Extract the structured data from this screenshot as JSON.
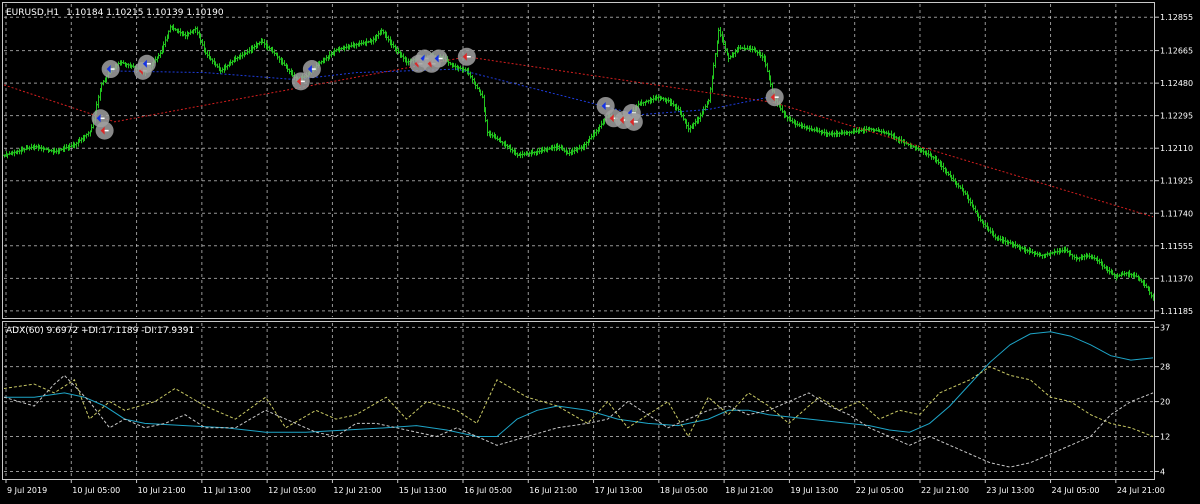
{
  "header": {
    "symbol": "EURUSD,H1",
    "ohlc": "1.10184 1.10215 1.10139 1.10190"
  },
  "indicator": {
    "label": "ADX(60) 9.6972 +DI:17.1189 -DI:17.9391"
  },
  "colors": {
    "background": "#000000",
    "frame": "#c8c8c8",
    "grid": "#c8c8c8",
    "bars": "#22c41e",
    "trend_line": "#d21e1e",
    "level_line": "#1e3cdc",
    "adx": "#1ea5c8",
    "plus_di": "#c8c864",
    "minus_di": "#c8c8c8",
    "marker_halo": "#a0a0a0",
    "marker_buy": "#1432e6",
    "marker_sell": "#dc2828",
    "text": "#ffffff"
  },
  "chart_data": [
    {
      "type": "candlestick",
      "title": "EURUSD,H1",
      "ylim": [
        1.1115,
        1.1293
      ],
      "y_ticks": [
        "1.12855",
        "1.12665",
        "1.12480",
        "1.12295",
        "1.12110",
        "1.11925",
        "1.11740",
        "1.11555",
        "1.11370",
        "1.11185"
      ],
      "x_ticks": [
        "9 Jul 2019",
        "10 Jul 05:00",
        "10 Jul 21:00",
        "11 Jul 13:00",
        "12 Jul 05:00",
        "12 Jul 21:00",
        "15 Jul 13:00",
        "16 Jul 05:00",
        "16 Jul 21:00",
        "17 Jul 13:00",
        "18 Jul 05:00",
        "18 Jul 21:00",
        "19 Jul 13:00",
        "22 Jul 05:00",
        "22 Jul 21:00",
        "23 Jul 13:00",
        "24 Jul 05:00",
        "24 Jul 21:00"
      ],
      "price_path": [
        [
          0,
          1.1207
        ],
        [
          3,
          1.1212
        ],
        [
          5,
          1.1209
        ],
        [
          7,
          1.1213
        ],
        [
          8.6,
          1.1221
        ],
        [
          9.6,
          1.1247
        ],
        [
          10.5,
          1.1255
        ],
        [
          11.5,
          1.126
        ],
        [
          13,
          1.1257
        ],
        [
          14,
          1.1254
        ],
        [
          15.5,
          1.1265
        ],
        [
          16.5,
          1.128
        ],
        [
          18,
          1.1275
        ],
        [
          19,
          1.1279
        ],
        [
          20,
          1.1265
        ],
        [
          21.5,
          1.1255
        ],
        [
          23,
          1.1262
        ],
        [
          24,
          1.1265
        ],
        [
          25.5,
          1.1272
        ],
        [
          27,
          1.1264
        ],
        [
          29,
          1.125
        ],
        [
          30,
          1.1252
        ],
        [
          31,
          1.1258
        ],
        [
          33,
          1.1267
        ],
        [
          35,
          1.127
        ],
        [
          36.5,
          1.1272
        ],
        [
          37.5,
          1.1278
        ],
        [
          38.5,
          1.127
        ],
        [
          40,
          1.126
        ],
        [
          41,
          1.1262
        ],
        [
          42.5,
          1.1263
        ],
        [
          43.5,
          1.1263
        ],
        [
          44.5,
          1.1258
        ],
        [
          46,
          1.1255
        ],
        [
          47.5,
          1.124
        ],
        [
          48,
          1.122
        ],
        [
          50,
          1.1212
        ],
        [
          51,
          1.1207
        ],
        [
          53,
          1.1209
        ],
        [
          55,
          1.1212
        ],
        [
          56,
          1.1208
        ],
        [
          57.5,
          1.1212
        ],
        [
          59,
          1.1222
        ],
        [
          60,
          1.123
        ],
        [
          61,
          1.1226
        ],
        [
          62,
          1.1229
        ],
        [
          63,
          1.1236
        ],
        [
          65,
          1.124
        ],
        [
          66,
          1.1238
        ],
        [
          67,
          1.1233
        ],
        [
          68,
          1.1222
        ],
        [
          69,
          1.1228
        ],
        [
          70,
          1.1238
        ],
        [
          71,
          1.1278
        ],
        [
          72,
          1.1262
        ],
        [
          73,
          1.1268
        ],
        [
          74.5,
          1.1267
        ],
        [
          75.5,
          1.1262
        ],
        [
          76.5,
          1.124
        ],
        [
          77.5,
          1.123
        ],
        [
          78.5,
          1.1225
        ],
        [
          80,
          1.1222
        ],
        [
          82,
          1.1219
        ],
        [
          84,
          1.122
        ],
        [
          86,
          1.1222
        ],
        [
          88,
          1.1219
        ],
        [
          89.5,
          1.1214
        ],
        [
          91,
          1.121
        ],
        [
          92.5,
          1.1205
        ],
        [
          94,
          1.1195
        ],
        [
          95.5,
          1.1185
        ],
        [
          97,
          1.117
        ],
        [
          98.5,
          1.116
        ],
        [
          100,
          1.1157
        ],
        [
          101.5,
          1.1153
        ],
        [
          103,
          1.115
        ],
        [
          104.5,
          1.1152
        ],
        [
          105.5,
          1.1153
        ],
        [
          106.5,
          1.1148
        ],
        [
          107.5,
          1.115
        ],
        [
          108.5,
          1.1148
        ],
        [
          109.5,
          1.1142
        ],
        [
          110.5,
          1.1138
        ],
        [
          111.5,
          1.114
        ],
        [
          112.5,
          1.1138
        ],
        [
          113.5,
          1.1132
        ],
        [
          114.2,
          1.1125
        ]
      ],
      "trend_line": [
        [
          0,
          1.1247
        ],
        [
          11,
          1.1226
        ],
        [
          46,
          1.1263
        ],
        [
          76.5,
          1.1237
        ],
        [
          114.2,
          1.1172
        ]
      ],
      "level_line": [
        [
          10,
          1.1255
        ],
        [
          20,
          1.1254
        ],
        [
          29,
          1.125
        ],
        [
          35,
          1.1254
        ],
        [
          45,
          1.1256
        ],
        [
          63,
          1.123
        ],
        [
          70,
          1.1233
        ],
        [
          76,
          1.124
        ]
      ],
      "markers": [
        {
          "x": 9.6,
          "y": 1.1228,
          "kind": "buy"
        },
        {
          "x": 10.0,
          "y": 1.1221,
          "kind": "sell"
        },
        {
          "x": 10.6,
          "y": 1.1256,
          "kind": "buy"
        },
        {
          "x": 13.8,
          "y": 1.1255,
          "kind": "sell"
        },
        {
          "x": 14.2,
          "y": 1.1259,
          "kind": "buy"
        },
        {
          "x": 29.5,
          "y": 1.1249,
          "kind": "sell"
        },
        {
          "x": 30.6,
          "y": 1.1256,
          "kind": "buy"
        },
        {
          "x": 41.2,
          "y": 1.1259,
          "kind": "sell"
        },
        {
          "x": 41.8,
          "y": 1.1262,
          "kind": "buy"
        },
        {
          "x": 42.5,
          "y": 1.1259,
          "kind": "sell"
        },
        {
          "x": 43.2,
          "y": 1.1262,
          "kind": "buy"
        },
        {
          "x": 46.0,
          "y": 1.1263,
          "kind": "sell"
        },
        {
          "x": 59.8,
          "y": 1.1235,
          "kind": "buy"
        },
        {
          "x": 60.6,
          "y": 1.1228,
          "kind": "sell"
        },
        {
          "x": 61.6,
          "y": 1.1227,
          "kind": "sell"
        },
        {
          "x": 62.4,
          "y": 1.1231,
          "kind": "buy"
        },
        {
          "x": 62.6,
          "y": 1.1226,
          "kind": "sell"
        },
        {
          "x": 76.6,
          "y": 1.124,
          "kind": "sell"
        }
      ]
    },
    {
      "type": "line",
      "title": "ADX(60) 9.6972 +DI:17.1189 -DI:17.9391",
      "ylim": [
        2.5,
        38
      ],
      "y_ticks": [
        "37",
        "28",
        "20",
        "12",
        "4"
      ],
      "series": [
        {
          "name": "ADX",
          "style": "solid",
          "points": [
            [
              0,
              21
            ],
            [
              3,
              21
            ],
            [
              6,
              22
            ],
            [
              8,
              21
            ],
            [
              10,
              19
            ],
            [
              12,
              16
            ],
            [
              14,
              15
            ],
            [
              18,
              14.5
            ],
            [
              22,
              14
            ],
            [
              26,
              13
            ],
            [
              30,
              13
            ],
            [
              34,
              13.5
            ],
            [
              38,
              14
            ],
            [
              41,
              14.5
            ],
            [
              44,
              13.5
            ],
            [
              47,
              12
            ],
            [
              49,
              12
            ],
            [
              51,
              16
            ],
            [
              53,
              18
            ],
            [
              55,
              19
            ],
            [
              58,
              18
            ],
            [
              61,
              16
            ],
            [
              64,
              15
            ],
            [
              67,
              14.5
            ],
            [
              70,
              16
            ],
            [
              72,
              18
            ],
            [
              74,
              18
            ],
            [
              76,
              17
            ],
            [
              78,
              16.5
            ],
            [
              82,
              15.5
            ],
            [
              86,
              14.5
            ],
            [
              88,
              13.5
            ],
            [
              90,
              13
            ],
            [
              92,
              15
            ],
            [
              94,
              19
            ],
            [
              96,
              24
            ],
            [
              98,
              29
            ],
            [
              100,
              33
            ],
            [
              102,
              35.5
            ],
            [
              104,
              36
            ],
            [
              106,
              35
            ],
            [
              108,
              33
            ],
            [
              110,
              30.5
            ],
            [
              112,
              29.5
            ],
            [
              114.2,
              30
            ]
          ]
        },
        {
          "name": "+DI",
          "style": "dashed",
          "points": [
            [
              0,
              23
            ],
            [
              3,
              24
            ],
            [
              5,
              22
            ],
            [
              7,
              25
            ],
            [
              8.5,
              16
            ],
            [
              10.5,
              20
            ],
            [
              12,
              18
            ],
            [
              15,
              20
            ],
            [
              17,
              23
            ],
            [
              20,
              19
            ],
            [
              23,
              16
            ],
            [
              26,
              21
            ],
            [
              28,
              14
            ],
            [
              31,
              18
            ],
            [
              33,
              16
            ],
            [
              35,
              17
            ],
            [
              38,
              21
            ],
            [
              40,
              16
            ],
            [
              42,
              20
            ],
            [
              45,
              18
            ],
            [
              47,
              15
            ],
            [
              49,
              25
            ],
            [
              52,
              21
            ],
            [
              55,
              19
            ],
            [
              58,
              15
            ],
            [
              60,
              20
            ],
            [
              62,
              14
            ],
            [
              64,
              17
            ],
            [
              66,
              20
            ],
            [
              68,
              12
            ],
            [
              70,
              21
            ],
            [
              72,
              17
            ],
            [
              74,
              22
            ],
            [
              76,
              19
            ],
            [
              78,
              15
            ],
            [
              81,
              21
            ],
            [
              83,
              18
            ],
            [
              85,
              20
            ],
            [
              87,
              16
            ],
            [
              89,
              18
            ],
            [
              91,
              17
            ],
            [
              93,
              22
            ],
            [
              96,
              25
            ],
            [
              98,
              28
            ],
            [
              100,
              26
            ],
            [
              102,
              25
            ],
            [
              104,
              21
            ],
            [
              106,
              20
            ],
            [
              108,
              17
            ],
            [
              110,
              15
            ],
            [
              112,
              14
            ],
            [
              114.2,
              12
            ]
          ]
        },
        {
          "name": "-DI",
          "style": "dashed",
          "points": [
            [
              0,
              21
            ],
            [
              3,
              19
            ],
            [
              5,
              24
            ],
            [
              6,
              26
            ],
            [
              8.5,
              20
            ],
            [
              10.5,
              14
            ],
            [
              12,
              16
            ],
            [
              14,
              14
            ],
            [
              16,
              15
            ],
            [
              18,
              17
            ],
            [
              20,
              14
            ],
            [
              23,
              14
            ],
            [
              26,
              18
            ],
            [
              28,
              16
            ],
            [
              31,
              13
            ],
            [
              33,
              12
            ],
            [
              35,
              15
            ],
            [
              37,
              15
            ],
            [
              39,
              14
            ],
            [
              41,
              13
            ],
            [
              43,
              12
            ],
            [
              45,
              14
            ],
            [
              47,
              12
            ],
            [
              49,
              10
            ],
            [
              52,
              12
            ],
            [
              55,
              14
            ],
            [
              58,
              15
            ],
            [
              60,
              16
            ],
            [
              62,
              20
            ],
            [
              64,
              17
            ],
            [
              66,
              14
            ],
            [
              68,
              16
            ],
            [
              70,
              18
            ],
            [
              72,
              19
            ],
            [
              74,
              17
            ],
            [
              76,
              18
            ],
            [
              78,
              20
            ],
            [
              80,
              22
            ],
            [
              82,
              19
            ],
            [
              84,
              17
            ],
            [
              86,
              14
            ],
            [
              88,
              12
            ],
            [
              90,
              10
            ],
            [
              92,
              12
            ],
            [
              94,
              10
            ],
            [
              96,
              8
            ],
            [
              98,
              6
            ],
            [
              100,
              5
            ],
            [
              102,
              6
            ],
            [
              104,
              8
            ],
            [
              106,
              10
            ],
            [
              108,
              12
            ],
            [
              110,
              17
            ],
            [
              112,
              20
            ],
            [
              114.2,
              22
            ]
          ]
        }
      ]
    }
  ]
}
